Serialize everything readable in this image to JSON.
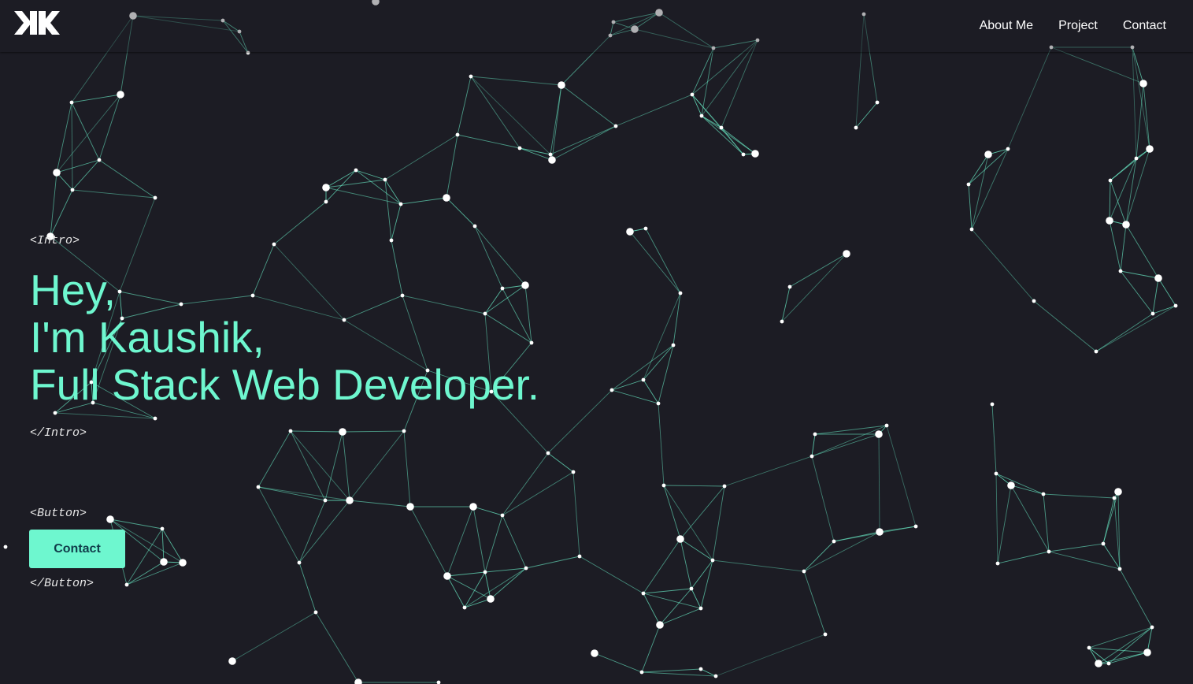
{
  "nav": {
    "logo_alt": "KK logo",
    "links": [
      "About Me",
      "Project",
      "Contact"
    ]
  },
  "hero": {
    "intro_open": "<Intro>",
    "line1": "Hey,",
    "line2": "I'm Kaushik,",
    "line3": "Full Stack Web Developer.",
    "intro_close": "</Intro>",
    "button_open": "<Button>",
    "button_label": "Contact",
    "button_close": "</Button>"
  },
  "colors": {
    "background": "#1c1c24",
    "accent": "#6ef7cf",
    "button_text": "#103d4a",
    "node": "#ffffff",
    "line": "#6ef7cf"
  },
  "icons": {
    "logo": "kk-logo-icon"
  }
}
